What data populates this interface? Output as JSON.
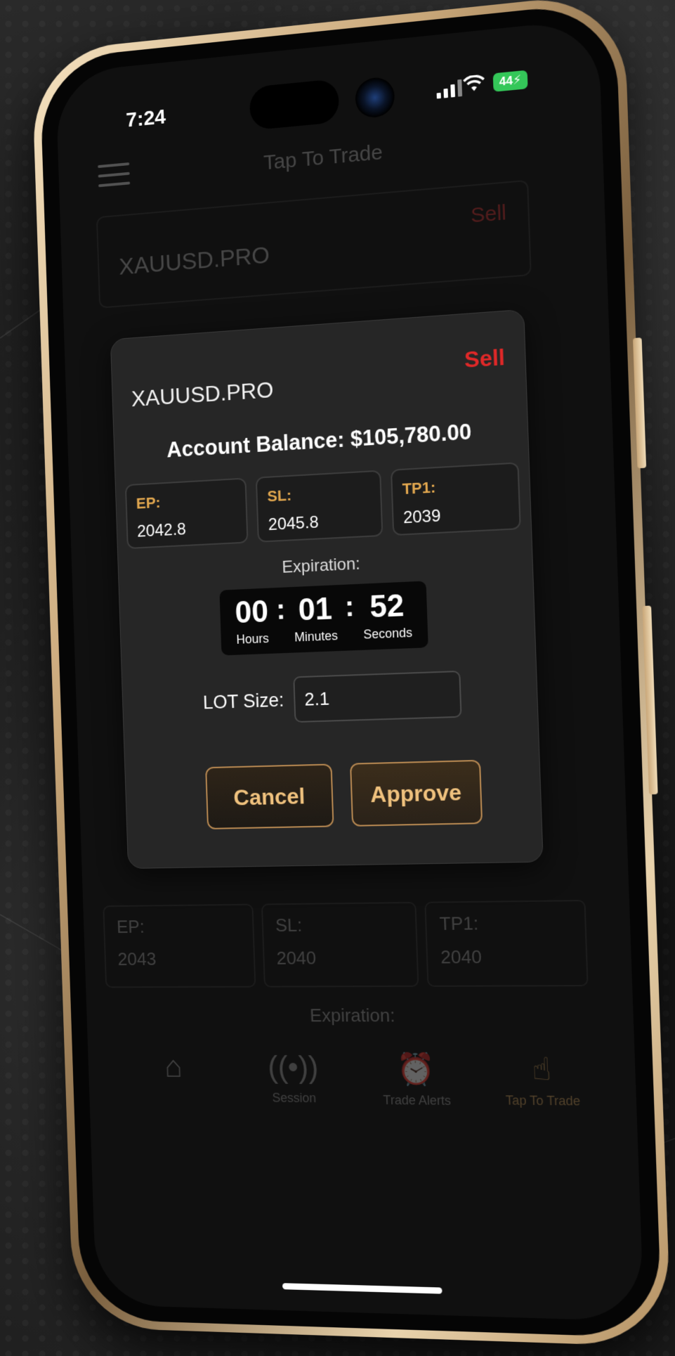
{
  "status": {
    "time": "7:24",
    "battery": "44"
  },
  "background_app": {
    "title": "Tap To Trade",
    "symbol": "XAUUSD.PRO",
    "side": "Sell",
    "fields": [
      {
        "label": "EP:",
        "value": "2043"
      },
      {
        "label": "SL:",
        "value": "2040"
      },
      {
        "label": "TP1:",
        "value": "2040"
      }
    ],
    "expiration_label": "Expiration:",
    "tabs": [
      {
        "icon": "home-icon",
        "label": ""
      },
      {
        "icon": "signal-icon",
        "label": "Session"
      },
      {
        "icon": "alarm-icon",
        "label": "Trade Alerts"
      },
      {
        "icon": "tap-hand-icon",
        "label": "Tap To Trade"
      }
    ]
  },
  "modal": {
    "symbol": "XAUUSD.PRO",
    "side": "Sell",
    "balance": "Account Balance: $105,780.00",
    "fields": [
      {
        "label": "EP:",
        "value": "2042.8"
      },
      {
        "label": "SL:",
        "value": "2045.8"
      },
      {
        "label": "TP1:",
        "value": "2039"
      }
    ],
    "expiration_label": "Expiration:",
    "timer": {
      "hours": "00",
      "hours_label": "Hours",
      "minutes": "01",
      "minutes_label": "Minutes",
      "seconds": "52",
      "seconds_label": "Seconds",
      "separator": ":"
    },
    "lot_label": "LOT Size:",
    "lot_value": "2.1",
    "cancel_label": "Cancel",
    "approve_label": "Approve"
  },
  "colors": {
    "sell": "#e02828",
    "accent_gold": "#e3a84f",
    "button_gold": "#b88952",
    "battery_green": "#34c759"
  }
}
